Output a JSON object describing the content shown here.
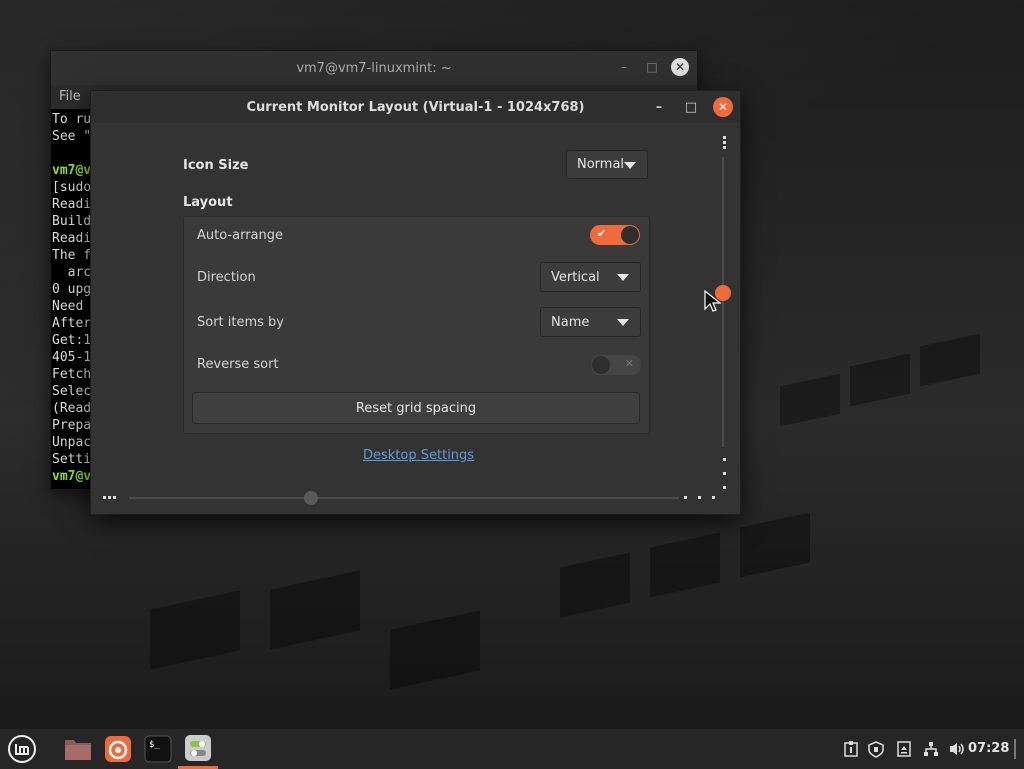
{
  "terminal": {
    "title": "vm7@vm7-linuxmint: ~",
    "menu_file": "File",
    "lines": [
      {
        "text": "To ru",
        "green": false
      },
      {
        "text": "See \"",
        "green": false
      },
      {
        "text": "",
        "green": false
      },
      {
        "text": "vm7@v",
        "green": true
      },
      {
        "text": "[sudo",
        "green": false
      },
      {
        "text": "Readi",
        "green": false
      },
      {
        "text": "Build",
        "green": false
      },
      {
        "text": "Readi",
        "green": false
      },
      {
        "text": "The f",
        "green": false
      },
      {
        "text": "  arc",
        "green": false
      },
      {
        "text": "0 upg",
        "green": false
      },
      {
        "text": "Need ",
        "green": false
      },
      {
        "text": "After",
        "green": false
      },
      {
        "text": "Get:1",
        "green": false
      },
      {
        "text": "405-1",
        "green": false
      },
      {
        "text": "Fetch",
        "green": false
      },
      {
        "text": "Selec",
        "green": false
      },
      {
        "text": "(Read",
        "green": false
      },
      {
        "text": "Prepa",
        "green": false
      },
      {
        "text": "Unpac",
        "green": false
      },
      {
        "text": "Setti",
        "green": false
      },
      {
        "text": "vm7@v",
        "green": true
      }
    ]
  },
  "dialog": {
    "title": "Current Monitor Layout (Virtual-1 - 1024x768)",
    "icon_size_label": "Icon Size",
    "icon_size_value": "Normal",
    "layout_label": "Layout",
    "auto_arrange_label": "Auto-arrange",
    "auto_arrange_on": true,
    "direction_label": "Direction",
    "direction_value": "Vertical",
    "sort_label": "Sort items by",
    "sort_value": "Name",
    "reverse_label": "Reverse sort",
    "reverse_on": false,
    "reset_button": "Reset grid spacing",
    "desktop_settings_link": "Desktop Settings"
  },
  "taskbar": {
    "clock": "07:28",
    "apps": [
      "menu-icon",
      "files-icon",
      "firefox-icon",
      "terminal-icon",
      "desktop-settings-icon"
    ],
    "tray": [
      "notes-icon",
      "shield-icon",
      "update-icon",
      "network-icon",
      "volume-icon"
    ]
  },
  "colors": {
    "accent": "#f06a3b",
    "link": "#5b9bd8"
  }
}
